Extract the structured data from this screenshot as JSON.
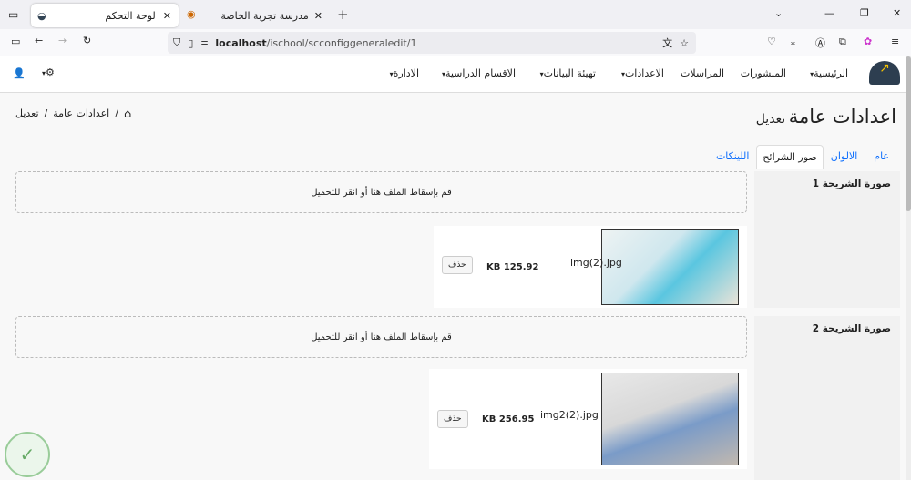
{
  "browser": {
    "tabs": [
      {
        "title": "لوحة التحكم",
        "active": true
      },
      {
        "title": "مدرسة تجربة الخاصة",
        "active": false
      }
    ],
    "url_host": "localhost",
    "url_path": "/ischool/scconfiggeneraledit/1"
  },
  "nav": {
    "items": [
      {
        "label": "الرئيسية",
        "dropdown": true
      },
      {
        "label": "المنشورات",
        "dropdown": false
      },
      {
        "label": "المراسلات",
        "dropdown": false
      },
      {
        "label": "الاعدادات",
        "dropdown": true
      },
      {
        "label": "تهيئة البيانات",
        "dropdown": true
      },
      {
        "label": "الاقسام الدراسية",
        "dropdown": true
      },
      {
        "label": "الادارة",
        "dropdown": true
      }
    ]
  },
  "page": {
    "title": "اعدادات عامة",
    "subtitle": "تعديل",
    "breadcrumb": [
      "اعدادات عامة",
      "تعديل"
    ]
  },
  "tabs": [
    {
      "label": "عام",
      "active": false
    },
    {
      "label": "الالوان",
      "active": false
    },
    {
      "label": "صور الشرائح",
      "active": true
    },
    {
      "label": "اللينكات",
      "active": false
    }
  ],
  "slides": [
    {
      "label": "صورة الشريحة 1",
      "dropzone": "قم بإسقاط الملف هنا أو انقر للتحميل",
      "file_name": "img(2).jpg",
      "file_size": "KB 125.92",
      "delete_label": "حذف"
    },
    {
      "label": "صورة الشريحة 2",
      "dropzone": "قم بإسقاط الملف هنا أو انقر للتحميل",
      "file_name": "img2(2).jpg",
      "file_size": "KB 256.95",
      "delete_label": "حذف"
    }
  ]
}
